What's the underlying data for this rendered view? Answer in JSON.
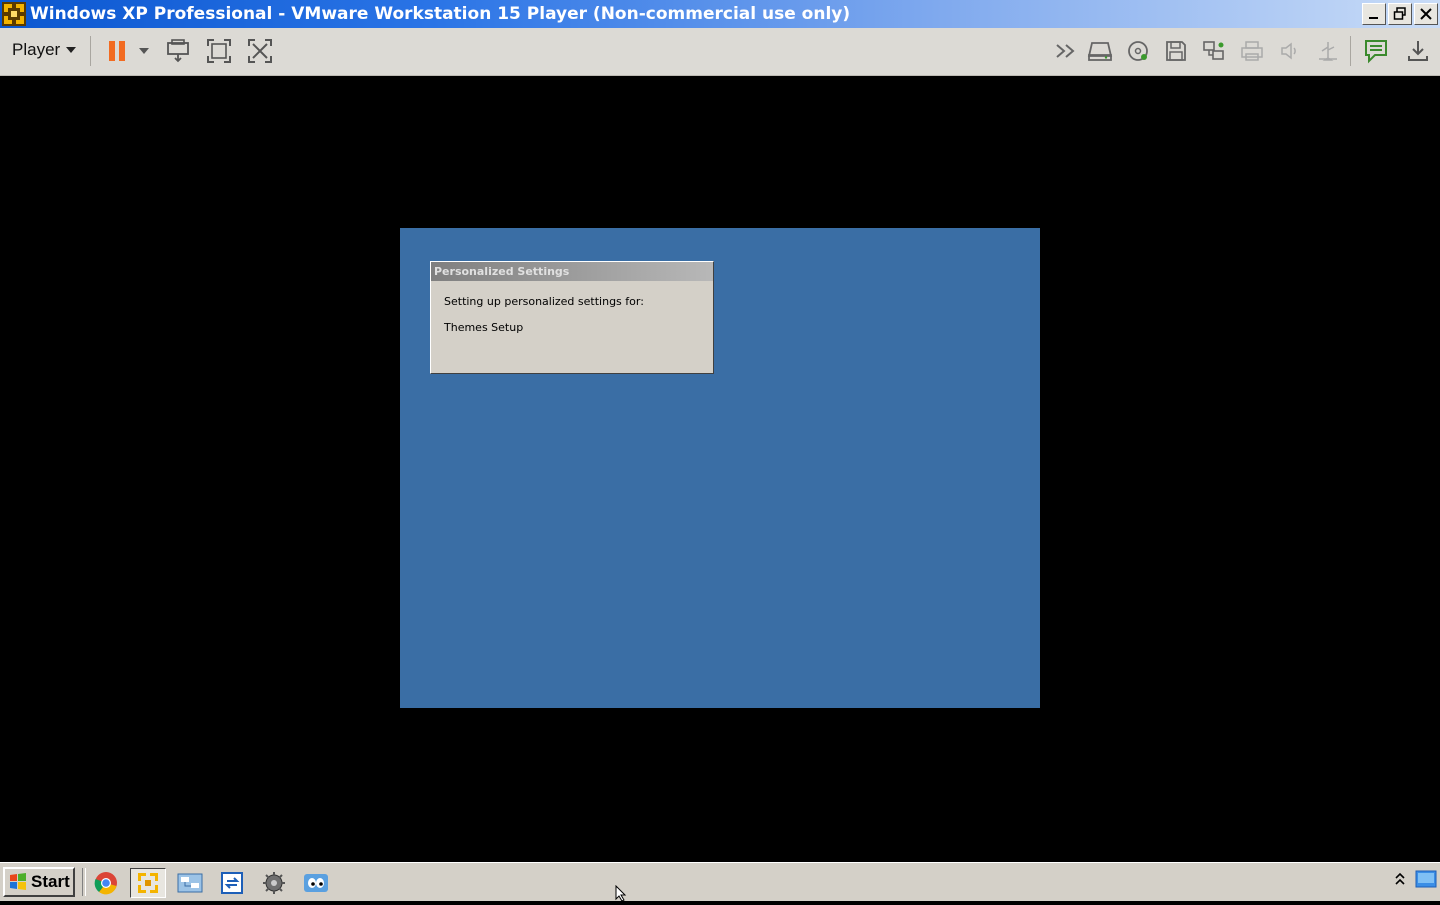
{
  "window": {
    "title": "Windows XP Professional - VMware Workstation 15 Player (Non-commercial use only)"
  },
  "toolbar": {
    "player_menu_label": "Player",
    "icons": [
      "pause-icon",
      "send-ctrl-alt-del-icon",
      "fullscreen-icon",
      "unity-icon",
      "fast-forward-icon",
      "hard-disk-icon",
      "cd-dvd-icon",
      "floppy-icon",
      "network-adapter-icon",
      "printer-icon",
      "sound-card-icon",
      "usb-icon",
      "message-log-icon",
      "download-icon"
    ]
  },
  "guest": {
    "background_color": "#3a6ea5",
    "dialog": {
      "title": "Personalized Settings",
      "line1": "Setting up personalized settings for:",
      "line2": "Themes Setup"
    }
  },
  "taskbar": {
    "start_label": "Start",
    "quick_launch": [
      "chrome-icon",
      "vmware-icon",
      "network-connections-icon",
      "refresh-icon",
      "settings-gear-icon",
      "eyes-icon"
    ]
  }
}
